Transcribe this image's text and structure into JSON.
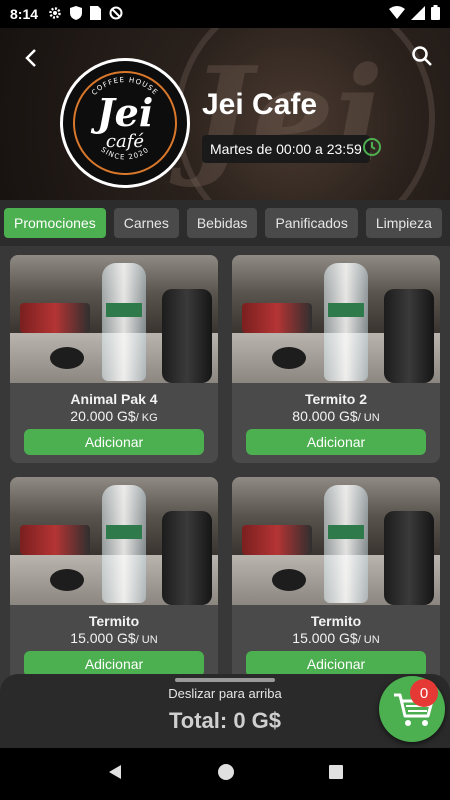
{
  "status_bar": {
    "time": "8:14"
  },
  "header": {
    "store_name": "Jei Cafe",
    "hours": "Martes de 00:00 a 23:59",
    "logo": {
      "top_text": "COFFEE HOUSE",
      "main": "Jei",
      "sub": "café",
      "bottom_text": "SINCE 2020"
    }
  },
  "tabs": [
    {
      "label": "Promociones",
      "active": true
    },
    {
      "label": "Carnes",
      "active": false
    },
    {
      "label": "Bebidas",
      "active": false
    },
    {
      "label": "Panificados",
      "active": false
    },
    {
      "label": "Limpieza",
      "active": false
    }
  ],
  "products": [
    {
      "name": "Animal Pak  4",
      "price": "20.000 G$",
      "unit": "/ KG",
      "button": "Adicionar"
    },
    {
      "name": "Termito 2",
      "price": "80.000 G$",
      "unit": "/ UN",
      "button": "Adicionar"
    },
    {
      "name": "Termito",
      "price": "15.000 G$",
      "unit": "/ UN",
      "button": "Adicionar"
    },
    {
      "name": "Termito",
      "price": "15.000 G$",
      "unit": "/ UN",
      "button": "Adicionar"
    }
  ],
  "cart_sheet": {
    "hint": "Deslizar para arriba",
    "total": "Total: 0 G$"
  },
  "cart": {
    "count": "0"
  },
  "colors": {
    "accent": "#4caf50",
    "badge": "#e53935"
  }
}
